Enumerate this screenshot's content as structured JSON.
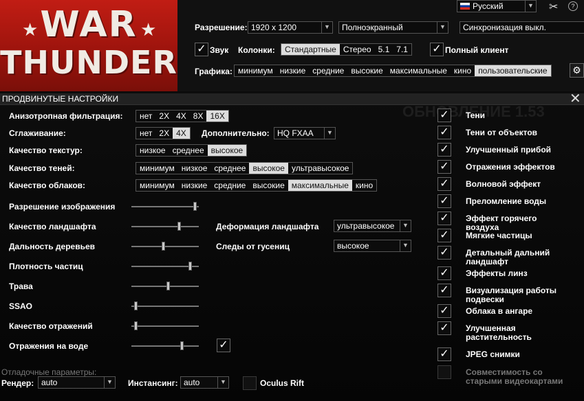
{
  "logo": {
    "line1": "WAR",
    "line2": "THUNDER"
  },
  "language": {
    "flag_colors": [
      "#ffffff",
      "#0039a6",
      "#d52b1e"
    ],
    "label": "Русский"
  },
  "top": {
    "resolution_label": "Разрешение:",
    "resolution_value": "1920 x 1200",
    "mode_value": "Полноэкранный",
    "vsync_value": "Синхронизация выкл.",
    "sound_label": "Звук",
    "speakers_label": "Колонки:",
    "speakers_options": [
      "Стандартные",
      "Стерео",
      "5.1",
      "7.1"
    ],
    "speakers_selected": 0,
    "full_client_label": "Полный клиент",
    "graphics_label": "Графика:",
    "graphics_options": [
      "минимум",
      "низкие",
      "средние",
      "высокие",
      "максимальные",
      "кино",
      "пользовательские"
    ],
    "graphics_selected": 6
  },
  "advanced": {
    "title": "ПРОДВИНУТЫЕ НАСТРОЙКИ",
    "bg_ghost_text": "ОБНОВЛЕНИЕ 1.53"
  },
  "rows": {
    "aniso": {
      "label": "Анизотропная фильтрация:",
      "options": [
        "нет",
        "2X",
        "4X",
        "8X",
        "16X"
      ],
      "selected": 4
    },
    "aa": {
      "label": "Сглаживание:",
      "options": [
        "нет",
        "2X",
        "4X"
      ],
      "selected": 2,
      "extra_label": "Дополнительно:",
      "extra_value": "HQ FXAA"
    },
    "tex": {
      "label": "Качество текстур:",
      "options": [
        "низкое",
        "среднее",
        "высокое"
      ],
      "selected": 2
    },
    "shadow": {
      "label": "Качество теней:",
      "options": [
        "минимум",
        "низкое",
        "среднее",
        "высокое",
        "ультравысокое"
      ],
      "selected": 3
    },
    "clouds": {
      "label": "Качество облаков:",
      "options": [
        "минимум",
        "низкие",
        "средние",
        "высокие",
        "максимальные",
        "кино"
      ],
      "selected": 4
    }
  },
  "sliders": [
    {
      "label": "Разрешение изображения",
      "value": 0.97
    },
    {
      "label": "Качество ландшафта",
      "value": 0.72
    },
    {
      "label": "Дальность деревьев",
      "value": 0.47
    },
    {
      "label": "Плотность частиц",
      "value": 0.89
    },
    {
      "label": "Трава",
      "value": 0.55
    },
    {
      "label": "SSAO",
      "value": 0.04
    },
    {
      "label": "Качество отражений",
      "value": 0.04
    },
    {
      "label": "Отражения на воде",
      "value": 0.76
    }
  ],
  "terrain_deform": {
    "label": "Деформация ландшафта",
    "value": "ультравысокое"
  },
  "tracks": {
    "label": "Следы от гусениц",
    "value": "высокое"
  },
  "checks": [
    {
      "label": "Тени",
      "checked": true
    },
    {
      "label": "Тени от объектов",
      "checked": true
    },
    {
      "label": "Улучшенный прибой",
      "checked": true
    },
    {
      "label": "Отражения эффектов",
      "checked": true
    },
    {
      "label": "Волновой эффект",
      "checked": true
    },
    {
      "label": "Преломление воды",
      "checked": true
    },
    {
      "label": "Эффект горячего воздуха",
      "checked": true
    },
    {
      "label": "Мягкие частицы",
      "checked": true
    },
    {
      "label": "Детальный дальний ландшафт",
      "checked": true
    },
    {
      "label": "Эффекты линз",
      "checked": true
    },
    {
      "label": "Визуализация работы подвески",
      "checked": true
    },
    {
      "label": "Облака в ангаре",
      "checked": true
    },
    {
      "label": "Улучшенная растительность",
      "checked": true
    },
    {
      "label": "JPEG снимки",
      "checked": true
    },
    {
      "label": "Совместимость со старыми видеокартами",
      "checked": false
    }
  ],
  "debug": {
    "title": "Отладочные параметры:",
    "render_label": "Рендер:",
    "render_value": "auto",
    "instancing_label": "Инстансинг:",
    "instancing_value": "auto",
    "oculus_label": "Oculus Rift"
  }
}
